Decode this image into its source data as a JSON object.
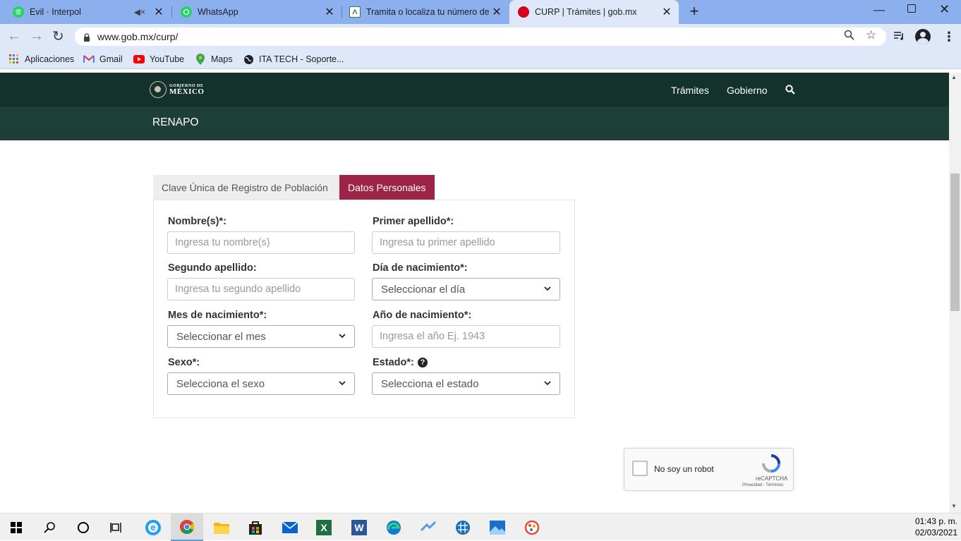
{
  "browser": {
    "tabs": [
      {
        "title": "Evil · Interpol",
        "favicon": "spotify-icon",
        "active": false,
        "muted": true
      },
      {
        "title": "WhatsApp",
        "favicon": "whatsapp-icon",
        "active": false
      },
      {
        "title": "Tramita o localiza tu número de s",
        "favicon": "imss-icon",
        "active": false
      },
      {
        "title": "CURP | Trámites | gob.mx",
        "favicon": "gobmx-icon",
        "active": true
      }
    ],
    "new_tab_label": "+",
    "url": "www.gob.mx/curp/",
    "bookmarks": [
      {
        "label": "Aplicaciones",
        "icon": "apps-grid-icon"
      },
      {
        "label": "Gmail",
        "icon": "gmail-icon"
      },
      {
        "label": "YouTube",
        "icon": "youtube-icon"
      },
      {
        "label": "Maps",
        "icon": "maps-icon"
      },
      {
        "label": "ITA TECH - Soporte...",
        "icon": "globe-icon"
      }
    ]
  },
  "site": {
    "logo_top": "GOBIERNO DE",
    "logo_bottom": "MÉXICO",
    "nav": [
      "Trámites",
      "Gobierno"
    ],
    "section": "RENAPO"
  },
  "form": {
    "tabs": [
      "Clave Única de Registro de Población",
      "Datos Personales"
    ],
    "active_tab": 1,
    "fields": {
      "nombre": {
        "label": "Nombre(s)*:",
        "placeholder": "Ingresa tu nombre(s)"
      },
      "primer_apellido": {
        "label": "Primer apellido*:",
        "placeholder": "Ingresa tu primer apellido"
      },
      "segundo_apellido": {
        "label": "Segundo apellido:",
        "placeholder": "Ingresa tu segundo apellido"
      },
      "dia": {
        "label": "Día de nacimiento*:",
        "value": "Seleccionar el día"
      },
      "mes": {
        "label": "Mes de nacimiento*:",
        "value": "Seleccionar el mes"
      },
      "anio": {
        "label": "Año de nacimiento*:",
        "placeholder": "Ingresa el año Ej. 1943"
      },
      "sexo": {
        "label": "Sexo*:",
        "value": "Selecciona el sexo"
      },
      "estado": {
        "label": "Estado*:",
        "value": "Selecciona el estado"
      }
    }
  },
  "captcha": {
    "label": "No soy un robot",
    "brand": "reCAPTCHA",
    "links": "Privacidad - Términos"
  },
  "taskbar": {
    "time": "01:43 p. m.",
    "date": "02/03/2021"
  },
  "colors": {
    "tabstrip": "#8bb0ed",
    "toolbar": "#dfe8f8",
    "gob_dark": "#13322b",
    "gob_green": "#1e3f35",
    "accent": "#9d2449"
  }
}
